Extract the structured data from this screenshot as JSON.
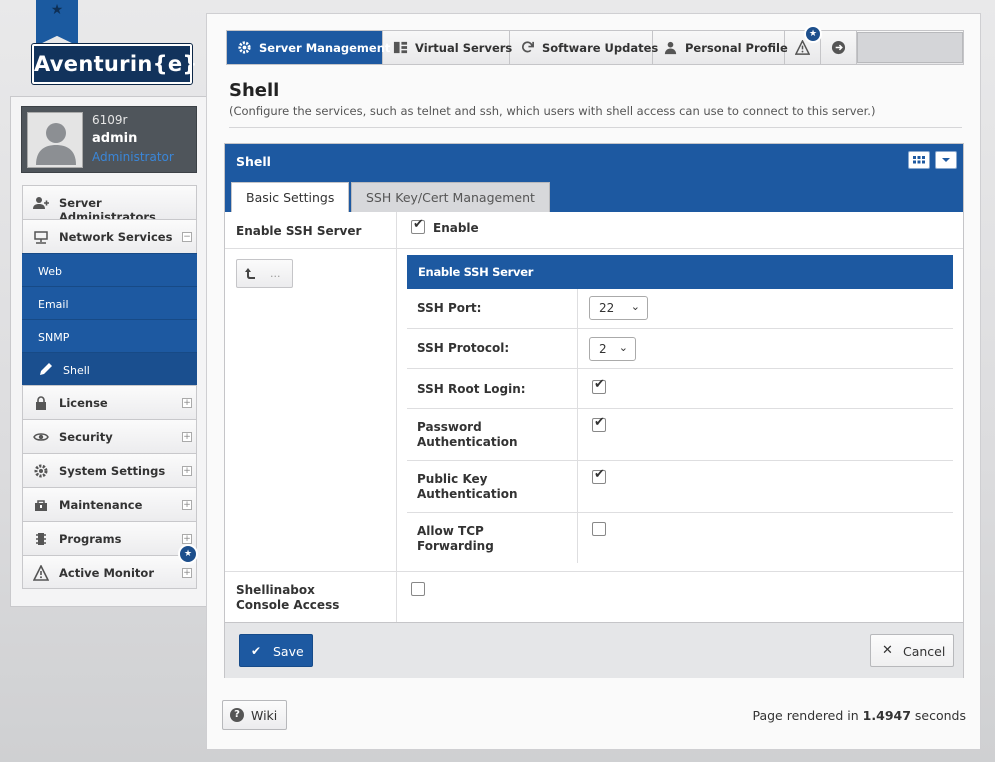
{
  "brand": {
    "logo_text": "Aventurin{e}"
  },
  "user": {
    "host": "6109r",
    "name": "admin",
    "role": "Administrator"
  },
  "sidebar": {
    "items": [
      {
        "label": "Server Administrators"
      },
      {
        "label": "Network Services",
        "expander": "−"
      },
      {
        "label": "License",
        "expander": "+"
      },
      {
        "label": "Security",
        "expander": "+"
      },
      {
        "label": "System Settings",
        "expander": "+"
      },
      {
        "label": "Maintenance",
        "expander": "+"
      },
      {
        "label": "Programs",
        "expander": "+"
      },
      {
        "label": "Active Monitor",
        "expander": "+"
      }
    ],
    "sub_items": [
      {
        "label": "Web"
      },
      {
        "label": "Email"
      },
      {
        "label": "SNMP"
      },
      {
        "label": "Shell"
      }
    ],
    "badge_icon": "★"
  },
  "topnav": {
    "tabs": [
      {
        "label": "Server Management"
      },
      {
        "label": "Virtual Servers"
      },
      {
        "label": "Software Updates"
      },
      {
        "label": "Personal Profile"
      }
    ],
    "badge_icon": "★"
  },
  "page": {
    "title": "Shell",
    "description": "(Configure the services, such as telnet and ssh, which users with shell access can use to connect to this server.)"
  },
  "panel": {
    "title": "Shell",
    "tabs": [
      {
        "label": "Basic Settings"
      },
      {
        "label": "SSH Key/Cert Management"
      }
    ],
    "enable_ssh": {
      "label": "Enable SSH Server",
      "checkbox_label": "Enable",
      "checked": true
    },
    "back_button": {
      "dots": "..."
    },
    "ssh_section": {
      "title": "Enable SSH Server",
      "port": {
        "label": "SSH Port:",
        "value": "22"
      },
      "protocol": {
        "label": "SSH Protocol:",
        "value": "2"
      },
      "root_login": {
        "label": "SSH Root Login:",
        "checked": true
      },
      "password_auth": {
        "label": "Password Authentication",
        "checked": true
      },
      "pubkey_auth": {
        "label": "Public Key Authentication",
        "checked": true
      },
      "tcp_forwarding": {
        "label": "Allow TCP Forwarding",
        "checked": false
      }
    },
    "shellinabox": {
      "label": "Shellinabox Console Access",
      "checked": false
    }
  },
  "actions": {
    "save_label": "Save",
    "cancel_label": "Cancel"
  },
  "footer": {
    "wiki_label": "Wiki",
    "render_prefix": "Page rendered in",
    "render_value": "1.4947",
    "render_suffix": "seconds"
  },
  "colors": {
    "accent": "#1d59a1",
    "dark": "#12335c"
  }
}
